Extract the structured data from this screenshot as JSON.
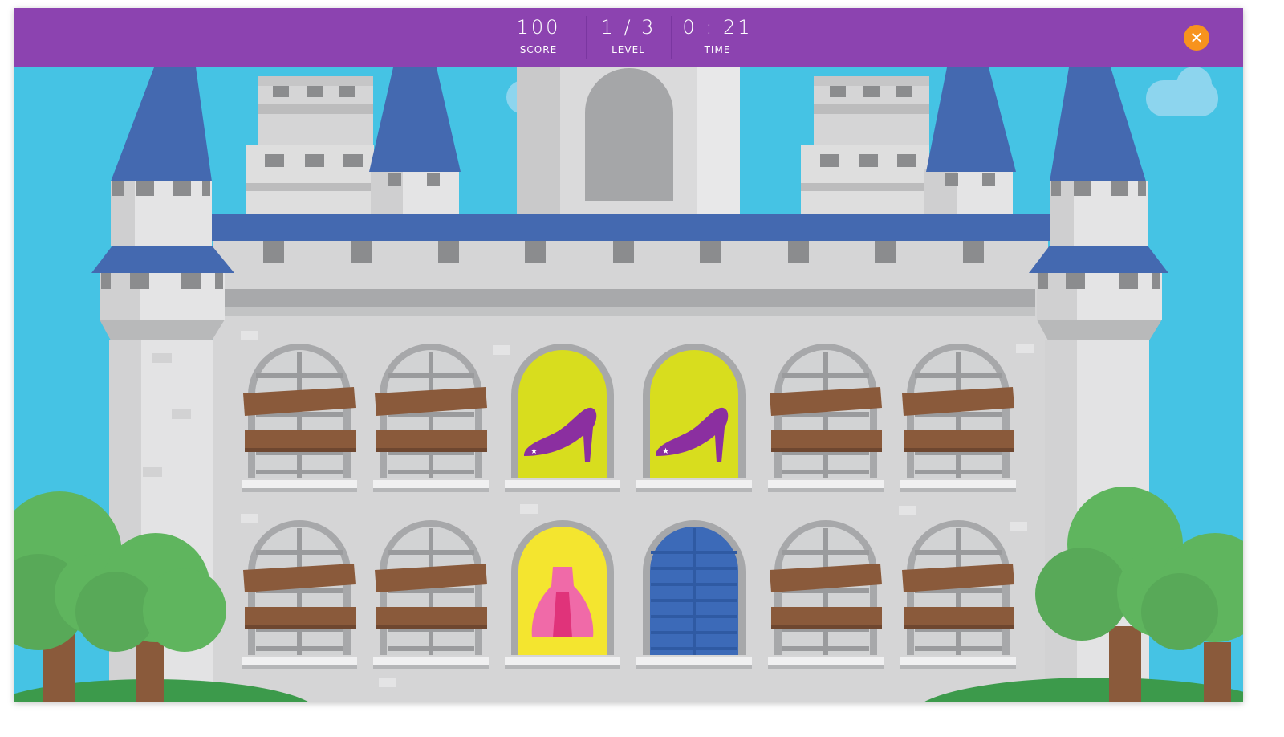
{
  "hud": {
    "score": {
      "value": "100",
      "label": "SCORE"
    },
    "level": {
      "value": "1 / 3",
      "label": "LEVEL"
    },
    "time": {
      "value": "0 : 21",
      "label": "TIME"
    },
    "close_icon": "close-icon"
  },
  "game": {
    "windows": [
      [
        "boarded",
        "boarded",
        "glass-slipper",
        "glass-slipper",
        "boarded",
        "boarded"
      ],
      [
        "boarded",
        "boarded",
        "ball-gown",
        "closed-door",
        "boarded",
        "boarded"
      ]
    ]
  },
  "colors": {
    "hud_bar": "#8c43b0",
    "close_button": "#f7931e",
    "sky": "#45c3e4",
    "roof": "#4469b0",
    "castle_wall": "#d5d5d6",
    "board": "#8a5a3b",
    "window_highlight": "#d8dd1e",
    "door": "#3c6ab8",
    "slipper": "#8b2fa0",
    "gown": "#f06aa8",
    "tree": "#5fb55e"
  }
}
